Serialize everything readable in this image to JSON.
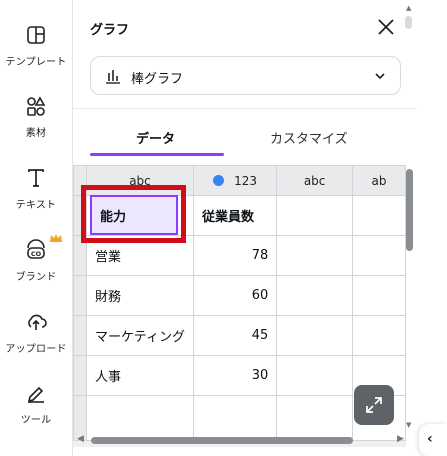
{
  "rail": {
    "items": [
      {
        "label": "テンプレート",
        "icon": "template-icon"
      },
      {
        "label": "素材",
        "icon": "elements-icon"
      },
      {
        "label": "テキスト",
        "icon": "text-icon"
      },
      {
        "label": "ブランド",
        "icon": "brand-icon"
      },
      {
        "label": "アップロード",
        "icon": "upload-icon"
      },
      {
        "label": "ツール",
        "icon": "tools-icon"
      }
    ]
  },
  "panel": {
    "title": "グラフ",
    "chart_type": "棒グラフ",
    "tabs": [
      {
        "label": "データ",
        "active": true
      },
      {
        "label": "カスタマイズ",
        "active": false
      }
    ]
  },
  "sheet": {
    "columns": [
      "abc",
      "123",
      "abc",
      "ab"
    ],
    "header_row": {
      "a": "能力",
      "b": "従業員数"
    },
    "rows": [
      {
        "a": "営業",
        "b": "78"
      },
      {
        "a": "財務",
        "b": "60"
      },
      {
        "a": "マーケティング",
        "b": "45"
      },
      {
        "a": "人事",
        "b": "30"
      }
    ]
  },
  "colors": {
    "accent": "#8b3dff",
    "series": "#3b82f6",
    "highlight": "#d10e17"
  }
}
